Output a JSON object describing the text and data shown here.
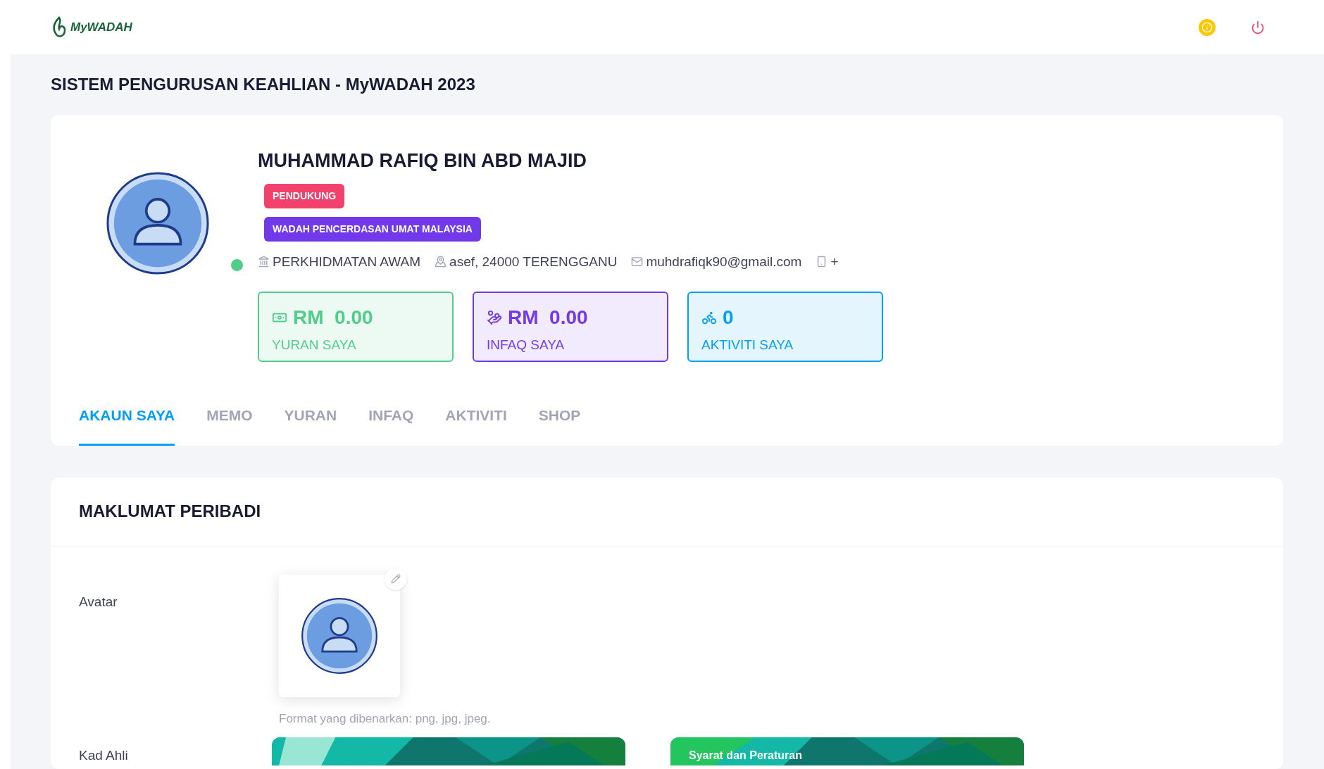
{
  "header": {
    "logo_text": "MyWADAH"
  },
  "page_title": "SISTEM PENGURUSAN KEAHLIAN - MyWADAH 2023",
  "profile": {
    "name": "MUHAMMAD RAFIQ BIN ABD MAJID",
    "online": true,
    "badges": [
      {
        "label": "PENDUKUNG",
        "color": "#f1416c"
      },
      {
        "label": "WADAH PENCERDASAN UMAT MALAYSIA",
        "color": "#7239ea"
      }
    ],
    "details": [
      {
        "kind": "sector",
        "text": "PERKHIDMATAN AWAM"
      },
      {
        "kind": "address",
        "text": "asef, 24000 TERENGGANU"
      },
      {
        "kind": "email",
        "text": "muhdrafiqk90@gmail.com"
      },
      {
        "kind": "phone",
        "text": "+"
      }
    ],
    "stats": [
      {
        "kind": "yuran",
        "value": "RM  0.00",
        "label": "YURAN SAYA",
        "color": "#50cd89"
      },
      {
        "kind": "infaq",
        "value": "RM  0.00",
        "label": "INFAQ SAYA",
        "color": "#7239ea"
      },
      {
        "kind": "aktiviti",
        "value": "0",
        "label": "AKTIVITI SAYA",
        "color": "#009ef7"
      }
    ]
  },
  "tabs": [
    {
      "label": "AKAUN SAYA",
      "selected": true
    },
    {
      "label": "MEMO",
      "selected": false
    },
    {
      "label": "YURAN",
      "selected": false
    },
    {
      "label": "INFAQ",
      "selected": false
    },
    {
      "label": "AKTIVITI",
      "selected": false
    },
    {
      "label": "SHOP",
      "selected": false
    }
  ],
  "section": {
    "title": "MAKLUMAT PERIBADI",
    "avatar_label": "Avatar",
    "avatar_hint": "Format yang dibenarkan: png, jpg, jpeg.",
    "card_label": "Kad Ahli",
    "card_caption": "Syarat dan Peraturan"
  }
}
